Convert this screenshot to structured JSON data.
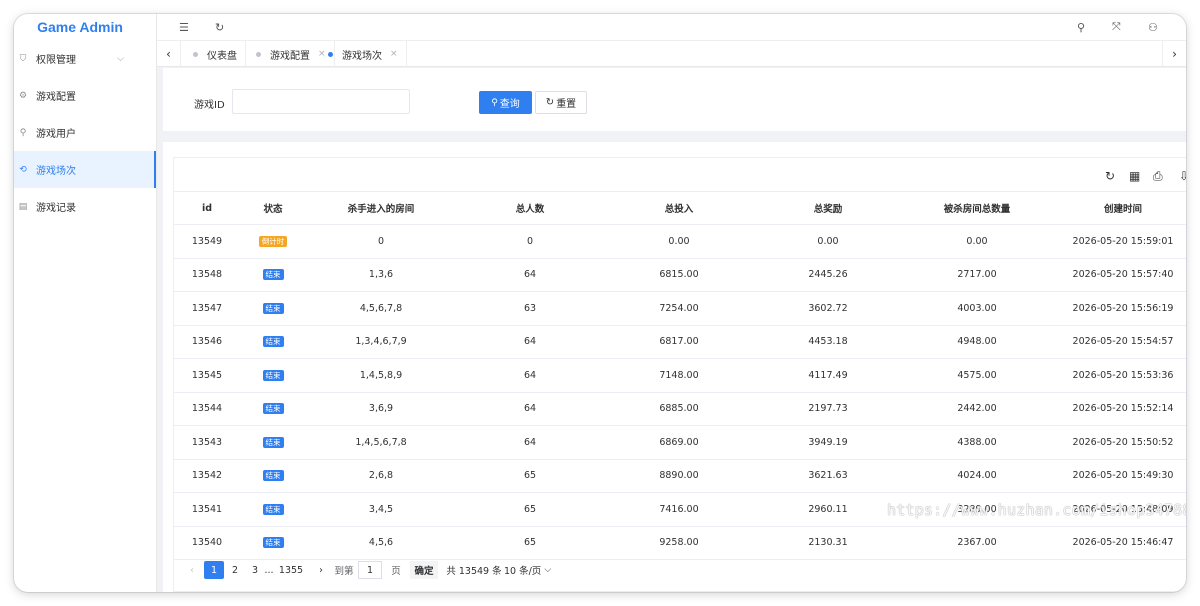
{
  "app": {
    "title": "Game Admin"
  },
  "sidebar": {
    "items": [
      {
        "label": "权限管理",
        "icon": "shield-icon",
        "glyph": "⛉",
        "active": false
      },
      {
        "label": "游戏配置",
        "icon": "gear-icon",
        "glyph": "⚙",
        "active": false
      },
      {
        "label": "游戏用户",
        "icon": "user-icon",
        "glyph": "⚲",
        "active": false
      },
      {
        "label": "游戏场次",
        "icon": "refresh-icon",
        "glyph": "⟲",
        "active": true
      },
      {
        "label": "游戏记录",
        "icon": "document-icon",
        "glyph": "▤",
        "active": false
      }
    ],
    "chevron": "⌵"
  },
  "header": {
    "collapse_glyph": "☰",
    "refresh_glyph": "↻",
    "search_glyph": "⚲",
    "fullscreen_glyph": "⤧",
    "user_glyph": "⚇"
  },
  "tabs": [
    {
      "label": "仪表盘",
      "closable": false,
      "active": false
    },
    {
      "label": "游戏配置",
      "closable": true,
      "active": false
    },
    {
      "label": "游戏场次",
      "closable": true,
      "active": true
    }
  ],
  "tab_nav": {
    "left": "‹",
    "right": "›",
    "close": "×"
  },
  "search": {
    "label": "游戏ID",
    "value": "",
    "query_label": "查询",
    "reset_label": "重置",
    "query_glyph": "⚲",
    "reset_glyph": "↻"
  },
  "toolbar": {
    "refresh": "↻",
    "columns": "▦",
    "print": "⎙",
    "export": "⇩"
  },
  "table": {
    "columns": [
      "id",
      "状态",
      "杀手进入的房间",
      "总人数",
      "总投入",
      "总奖励",
      "被杀房间总数量",
      "创建时间"
    ],
    "rows": [
      {
        "id": "13549",
        "status": "倒计时",
        "status_color": "#f5a623",
        "rooms": "0",
        "players": "0",
        "invest": "0.00",
        "reward": "0.00",
        "killed": "0.00",
        "created": "2026-05-20 15:59:01"
      },
      {
        "id": "13548",
        "status": "结束",
        "status_color": "#2f7ff0",
        "rooms": "1,3,6",
        "players": "64",
        "invest": "6815.00",
        "reward": "2445.26",
        "killed": "2717.00",
        "created": "2026-05-20 15:57:40"
      },
      {
        "id": "13547",
        "status": "结束",
        "status_color": "#2f7ff0",
        "rooms": "4,5,6,7,8",
        "players": "63",
        "invest": "7254.00",
        "reward": "3602.72",
        "killed": "4003.00",
        "created": "2026-05-20 15:56:19"
      },
      {
        "id": "13546",
        "status": "结束",
        "status_color": "#2f7ff0",
        "rooms": "1,3,4,6,7,9",
        "players": "64",
        "invest": "6817.00",
        "reward": "4453.18",
        "killed": "4948.00",
        "created": "2026-05-20 15:54:57"
      },
      {
        "id": "13545",
        "status": "结束",
        "status_color": "#2f7ff0",
        "rooms": "1,4,5,8,9",
        "players": "64",
        "invest": "7148.00",
        "reward": "4117.49",
        "killed": "4575.00",
        "created": "2026-05-20 15:53:36"
      },
      {
        "id": "13544",
        "status": "结束",
        "status_color": "#2f7ff0",
        "rooms": "3,6,9",
        "players": "64",
        "invest": "6885.00",
        "reward": "2197.73",
        "killed": "2442.00",
        "created": "2026-05-20 15:52:14"
      },
      {
        "id": "13543",
        "status": "结束",
        "status_color": "#2f7ff0",
        "rooms": "1,4,5,6,7,8",
        "players": "64",
        "invest": "6869.00",
        "reward": "3949.19",
        "killed": "4388.00",
        "created": "2026-05-20 15:50:52"
      },
      {
        "id": "13542",
        "status": "结束",
        "status_color": "#2f7ff0",
        "rooms": "2,6,8",
        "players": "65",
        "invest": "8890.00",
        "reward": "3621.63",
        "killed": "4024.00",
        "created": "2026-05-20 15:49:30"
      },
      {
        "id": "13541",
        "status": "结束",
        "status_color": "#2f7ff0",
        "rooms": "3,4,5",
        "players": "65",
        "invest": "7416.00",
        "reward": "2960.11",
        "killed": "3289.00",
        "created": "2026-05-20 15:48:09"
      },
      {
        "id": "13540",
        "status": "结束",
        "status_color": "#2f7ff0",
        "rooms": "4,5,6",
        "players": "65",
        "invest": "9258.00",
        "reward": "2130.31",
        "killed": "2367.00",
        "created": "2026-05-20 15:46:47"
      }
    ]
  },
  "pagination": {
    "prev": "‹",
    "pages": [
      "1",
      "2",
      "3"
    ],
    "ellipsis": "...",
    "last_page": "1355",
    "next": "›",
    "goto_label": "到第",
    "goto_value": "1",
    "page_unit": "页",
    "confirm_label": "确定",
    "total_text": "共 13549 条",
    "page_size": "10 条/页",
    "page_size_glyph": "⌵"
  },
  "watermark": "https://www.huzhan.com/ishop34788",
  "colors": {
    "accent": "#2f7ff0",
    "warning": "#f5a623"
  }
}
